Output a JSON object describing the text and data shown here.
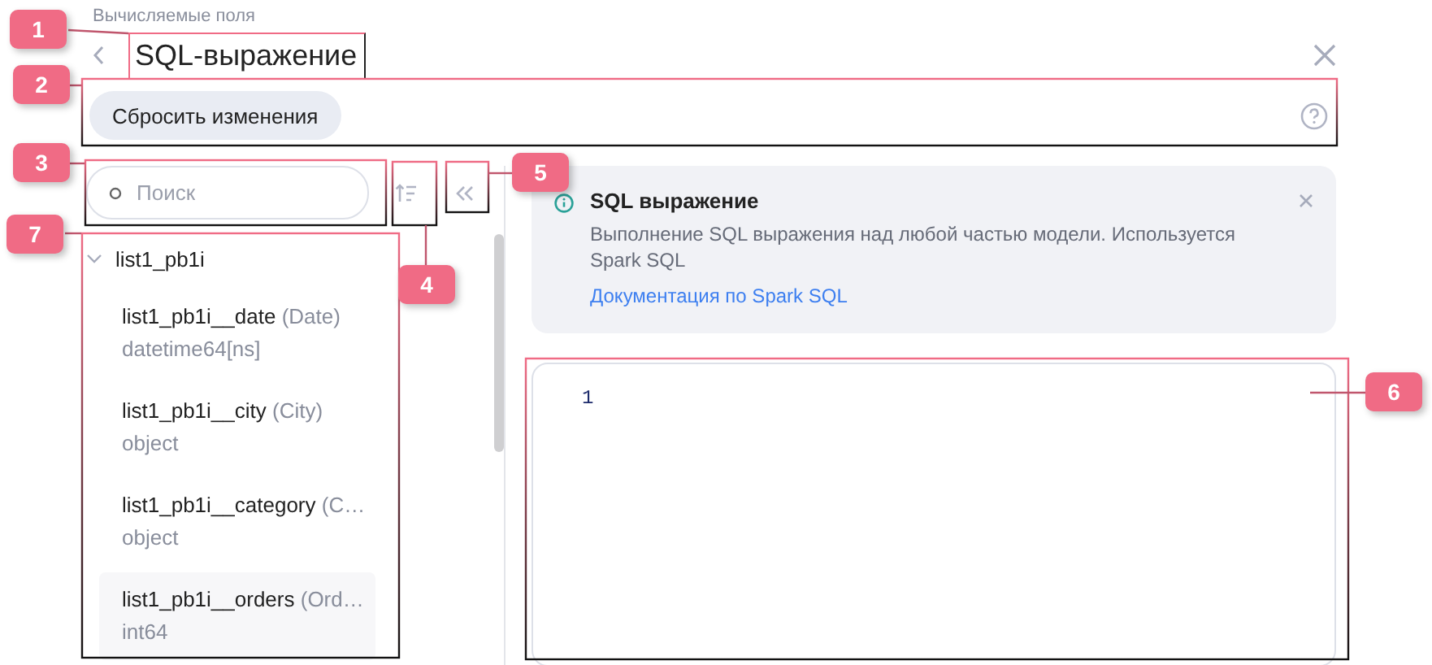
{
  "breadcrumb": "Вычисляемые поля",
  "title": "SQL-выражение",
  "toolbar": {
    "reset_button": "Сбросить изменения"
  },
  "search": {
    "placeholder": "Поиск"
  },
  "tree": [
    {
      "label": "list1_pb1i",
      "expanded": true,
      "children": [
        {
          "name": "list1_pb1i__date",
          "alias": "(Date)",
          "type": "datetime64[ns]",
          "selected": false
        },
        {
          "name": "list1_pb1i__city",
          "alias": "(City)",
          "type": "object",
          "selected": false
        },
        {
          "name": "list1_pb1i__category",
          "alias": "(C…",
          "type": "object",
          "selected": false
        },
        {
          "name": "list1_pb1i__orders",
          "alias": "(Ord…",
          "type": "int64",
          "selected": true
        }
      ]
    }
  ],
  "info": {
    "title": "SQL выражение",
    "text": "Выполнение SQL выражения над любой частью модели. Используется Spark SQL",
    "link": "Документация по Spark SQL"
  },
  "editor": {
    "line_numbers": [
      "1"
    ]
  },
  "callouts": [
    {
      "label": "1"
    },
    {
      "label": "2"
    },
    {
      "label": "3"
    },
    {
      "label": "4"
    },
    {
      "label": "5"
    },
    {
      "label": "6"
    },
    {
      "label": "7"
    }
  ]
}
